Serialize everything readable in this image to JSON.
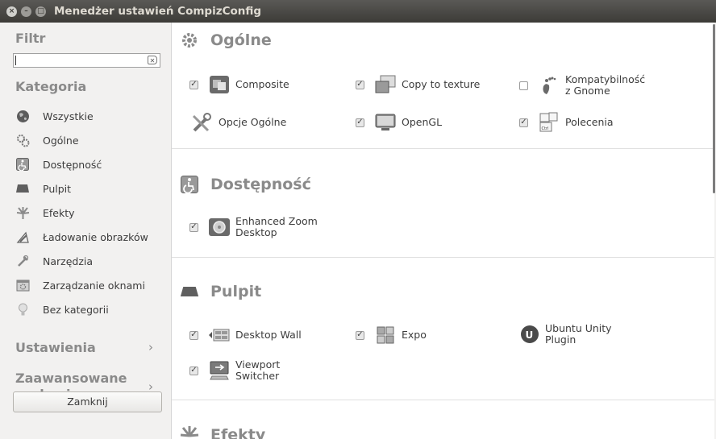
{
  "window": {
    "title": "Menedżer ustawień CompizConfig"
  },
  "sidebar": {
    "filter_label": "Filtr",
    "filter_value": "",
    "category_label": "Kategoria",
    "categories": [
      {
        "label": "Wszystkie",
        "icon": "globe-icon"
      },
      {
        "label": "Ogólne",
        "icon": "gears-icon"
      },
      {
        "label": "Dostępność",
        "icon": "accessibility-icon"
      },
      {
        "label": "Pulpit",
        "icon": "desktop-icon"
      },
      {
        "label": "Efekty",
        "icon": "effects-icon"
      },
      {
        "label": "Ładowanie obrazków",
        "icon": "image-loading-icon"
      },
      {
        "label": "Narzędzia",
        "icon": "tools-icon"
      },
      {
        "label": "Zarządzanie oknami",
        "icon": "window-management-icon"
      },
      {
        "label": "Bez kategorii",
        "icon": "uncategorized-icon"
      }
    ],
    "settings_label": "Ustawienia",
    "advanced_search_label_1": "Zaawansowane",
    "advanced_search_label_2": "szukanie",
    "close_button": "Zamknij"
  },
  "groups": {
    "general": {
      "title": "Ogólne",
      "plugins": [
        {
          "label": "Composite",
          "checked": true
        },
        {
          "label": "Copy to texture",
          "checked": true
        },
        {
          "label_1": "Kompatybilność",
          "label_2": "z Gnome",
          "checked": false
        },
        {
          "label": "Opcje Ogólne",
          "checked": null
        },
        {
          "label": "OpenGL",
          "checked": true
        },
        {
          "label": "Polecenia",
          "checked": true
        }
      ]
    },
    "accessibility": {
      "title": "Dostępność",
      "plugins": [
        {
          "label_1": "Enhanced Zoom",
          "label_2": "Desktop",
          "checked": true
        }
      ]
    },
    "desktop": {
      "title": "Pulpit",
      "plugins": [
        {
          "label": "Desktop Wall",
          "checked": true
        },
        {
          "label": "Expo",
          "checked": true
        },
        {
          "label_1": "Ubuntu Unity",
          "label_2": "Plugin",
          "checked": null
        },
        {
          "label_1": "Viewport",
          "label_2": "Switcher",
          "checked": true
        }
      ]
    },
    "effects": {
      "title": "Efekty"
    }
  },
  "check_mark": "✓",
  "colors": {
    "titlebar": "#3c3b37",
    "header_text": "#8a8a8a",
    "background": "#f2f1f0"
  }
}
